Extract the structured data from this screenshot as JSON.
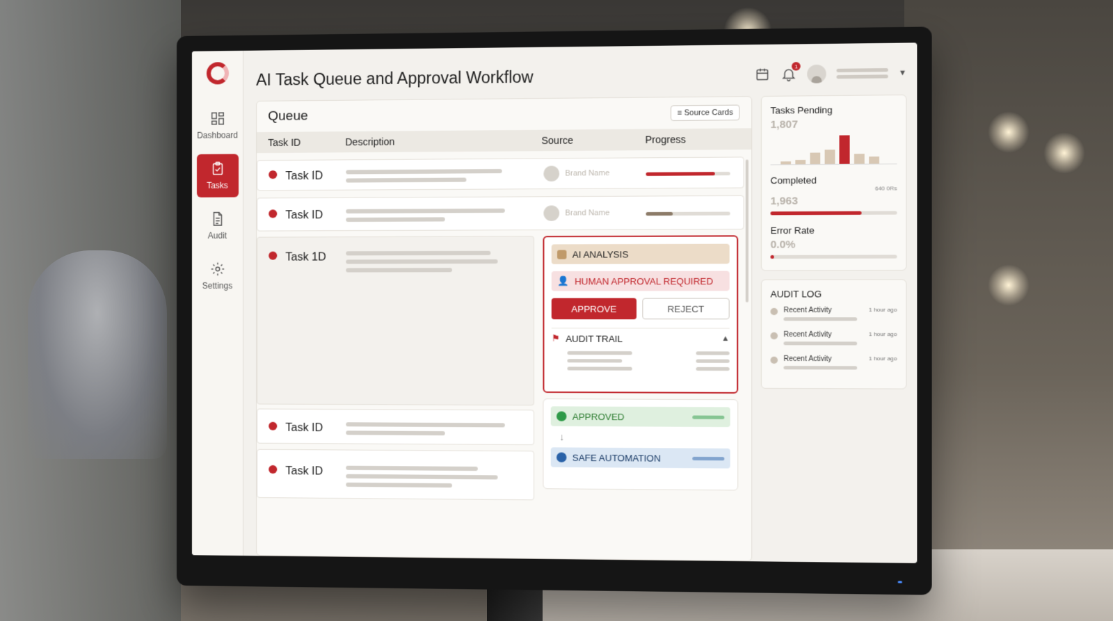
{
  "app": {
    "title": "AI Task Queue and Approval Workflow",
    "notification_count": "1"
  },
  "sidebar": {
    "items": [
      {
        "label": "Dashboard",
        "icon": "dashboard-icon",
        "active": false
      },
      {
        "label": "Tasks",
        "icon": "tasks-icon",
        "active": true
      },
      {
        "label": "Audit",
        "icon": "document-icon",
        "active": false
      },
      {
        "label": "Settings",
        "icon": "gear-icon",
        "active": false
      }
    ]
  },
  "queue": {
    "title": "Queue",
    "filter_label": "Source Cards",
    "columns": [
      "Task ID",
      "Description",
      "Source",
      "Progress"
    ],
    "rows": [
      {
        "id": "Task ID",
        "source": "Brand Name",
        "progress": 0.82,
        "progress_color": "#c1272d"
      },
      {
        "id": "Task ID",
        "source": "Brand Name",
        "progress": 0.32,
        "progress_color": "#8c7b68"
      },
      {
        "id": "Task 1D"
      },
      {
        "id": "Task ID"
      },
      {
        "id": "Task ID"
      }
    ]
  },
  "approval": {
    "ai_analysis": "AI ANALYSIS",
    "human_required": "HUMAN APPROVAL REQUIRED",
    "approve": "APPROVE",
    "reject": "REJECT",
    "audit_trail": "AUDIT TRAIL"
  },
  "flow": {
    "approved": "APPROVED",
    "safe_automation": "SAFE AUTOMATION"
  },
  "stats": {
    "pending": {
      "label": "Tasks Pending",
      "value": "1,807"
    },
    "completed": {
      "label": "Completed",
      "value": "1,963",
      "note": "640 0Rs",
      "progress": 0.72
    },
    "error": {
      "label": "Error Rate",
      "value": "0.0%",
      "progress": 0.03
    },
    "pending_bars": [
      0.1,
      0.15,
      0.4,
      0.5,
      1.0,
      0.35,
      0.25
    ]
  },
  "audit_log": {
    "title": "AUDIT LOG",
    "items": [
      {
        "label": "Recent Activity",
        "time": "1 hour ago"
      },
      {
        "label": "Recent Activity",
        "time": "1 hour ago"
      },
      {
        "label": "Recent Activity",
        "time": "1 hour ago"
      }
    ]
  },
  "colors": {
    "accent": "#c1272d",
    "approved": "#2e9a48",
    "automation": "#2a62a8"
  }
}
